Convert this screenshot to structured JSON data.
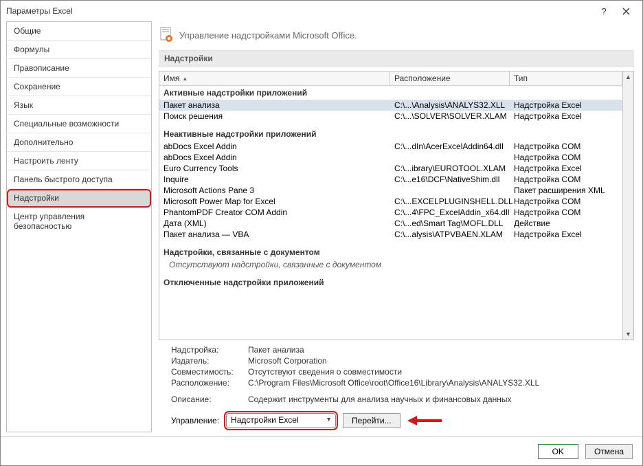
{
  "window": {
    "title": "Параметры Excel"
  },
  "sidebar": {
    "items": [
      "Общие",
      "Формулы",
      "Правописание",
      "Сохранение",
      "Язык",
      "Специальные возможности",
      "Дополнительно",
      "Настроить ленту",
      "Панель быстрого доступа",
      "Надстройки",
      "Центр управления безопасностью"
    ],
    "selected_index": 9
  },
  "heading": "Управление надстройками Microsoft Office.",
  "section_title": "Надстройки",
  "columns": {
    "name": "Имя",
    "location": "Расположение",
    "type": "Тип"
  },
  "groups": [
    {
      "title": "Активные надстройки приложений",
      "rows": [
        {
          "name": "Пакет анализа",
          "loc": "C:\\...\\Analysis\\ANALYS32.XLL",
          "type": "Надстройка Excel",
          "selected": true
        },
        {
          "name": "Поиск решения",
          "loc": "C:\\...\\SOLVER\\SOLVER.XLAM",
          "type": "Надстройка Excel"
        }
      ]
    },
    {
      "title": "Неактивные надстройки приложений",
      "rows": [
        {
          "name": "abDocs Excel Addin",
          "loc": "C:\\...dIn\\AcerExcelAddin64.dll",
          "type": "Надстройка COM"
        },
        {
          "name": "abDocs Excel Addin",
          "loc": "",
          "type": "Надстройка COM"
        },
        {
          "name": "Euro Currency Tools",
          "loc": "C:\\...ibrary\\EUROTOOL.XLAM",
          "type": "Надстройка Excel"
        },
        {
          "name": "Inquire",
          "loc": "C:\\...e16\\DCF\\NativeShim.dll",
          "type": "Надстройка COM"
        },
        {
          "name": "Microsoft Actions Pane 3",
          "loc": "",
          "type": "Пакет расширения XML"
        },
        {
          "name": "Microsoft Power Map for Excel",
          "loc": "C:\\...EXCELPLUGINSHELL.DLL",
          "type": "Надстройка COM"
        },
        {
          "name": "PhantomPDF Creator COM Addin",
          "loc": "C:\\...4\\FPC_ExcelAddin_x64.dll",
          "type": "Надстройка COM"
        },
        {
          "name": "Дата (XML)",
          "loc": "C:\\...ed\\Smart Tag\\MOFL.DLL",
          "type": "Действие"
        },
        {
          "name": "Пакет анализа — VBA",
          "loc": "C:\\...alysis\\ATPVBAEN.XLAM",
          "type": "Надстройка Excel"
        }
      ]
    },
    {
      "title": "Надстройки, связанные с документом",
      "empty_text": "Отсутствуют надстройки, связанные с документом",
      "rows": []
    },
    {
      "title": "Отключенные надстройки приложений",
      "rows": []
    }
  ],
  "details": {
    "labels": {
      "addin": "Надстройка:",
      "publisher": "Издатель:",
      "compat": "Совместимость:",
      "location": "Расположение:",
      "description": "Описание:"
    },
    "values": {
      "addin": "Пакет анализа",
      "publisher": "Microsoft Corporation",
      "compat": "Отсутствуют сведения о совместимости",
      "location": "C:\\Program Files\\Microsoft Office\\root\\Office16\\Library\\Analysis\\ANALYS32.XLL",
      "description": "Содержит инструменты для анализа научных и финансовых данных"
    }
  },
  "manage": {
    "label": "Управление:",
    "selected": "Надстройки Excel",
    "go": "Перейти..."
  },
  "footer": {
    "ok": "OK",
    "cancel": "Отмена"
  }
}
